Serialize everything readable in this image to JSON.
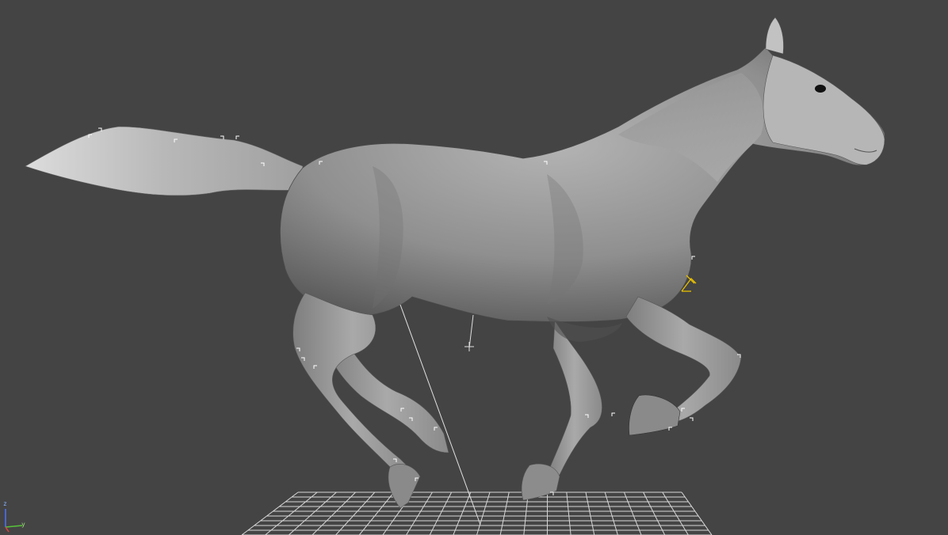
{
  "viewport": {
    "background_color": "#444444",
    "grid_color": "#d8d8d8",
    "model_color": "#9a9a9a",
    "bracket_color": "#ffffff",
    "gizmo_color": "#e8c000"
  },
  "axis_tripod": {
    "z_label": "z",
    "y_label": "y",
    "z_color": "#4a72ff",
    "y_color": "#58c33a",
    "x_color": "#e04040"
  },
  "scene_objects": {
    "model": "horse-mesh",
    "ground": "home-grid",
    "pivot": "center-helper",
    "icons": [
      "axis-tripod-icon",
      "move-gizmo-icon",
      "selection-bracket-icon"
    ]
  }
}
